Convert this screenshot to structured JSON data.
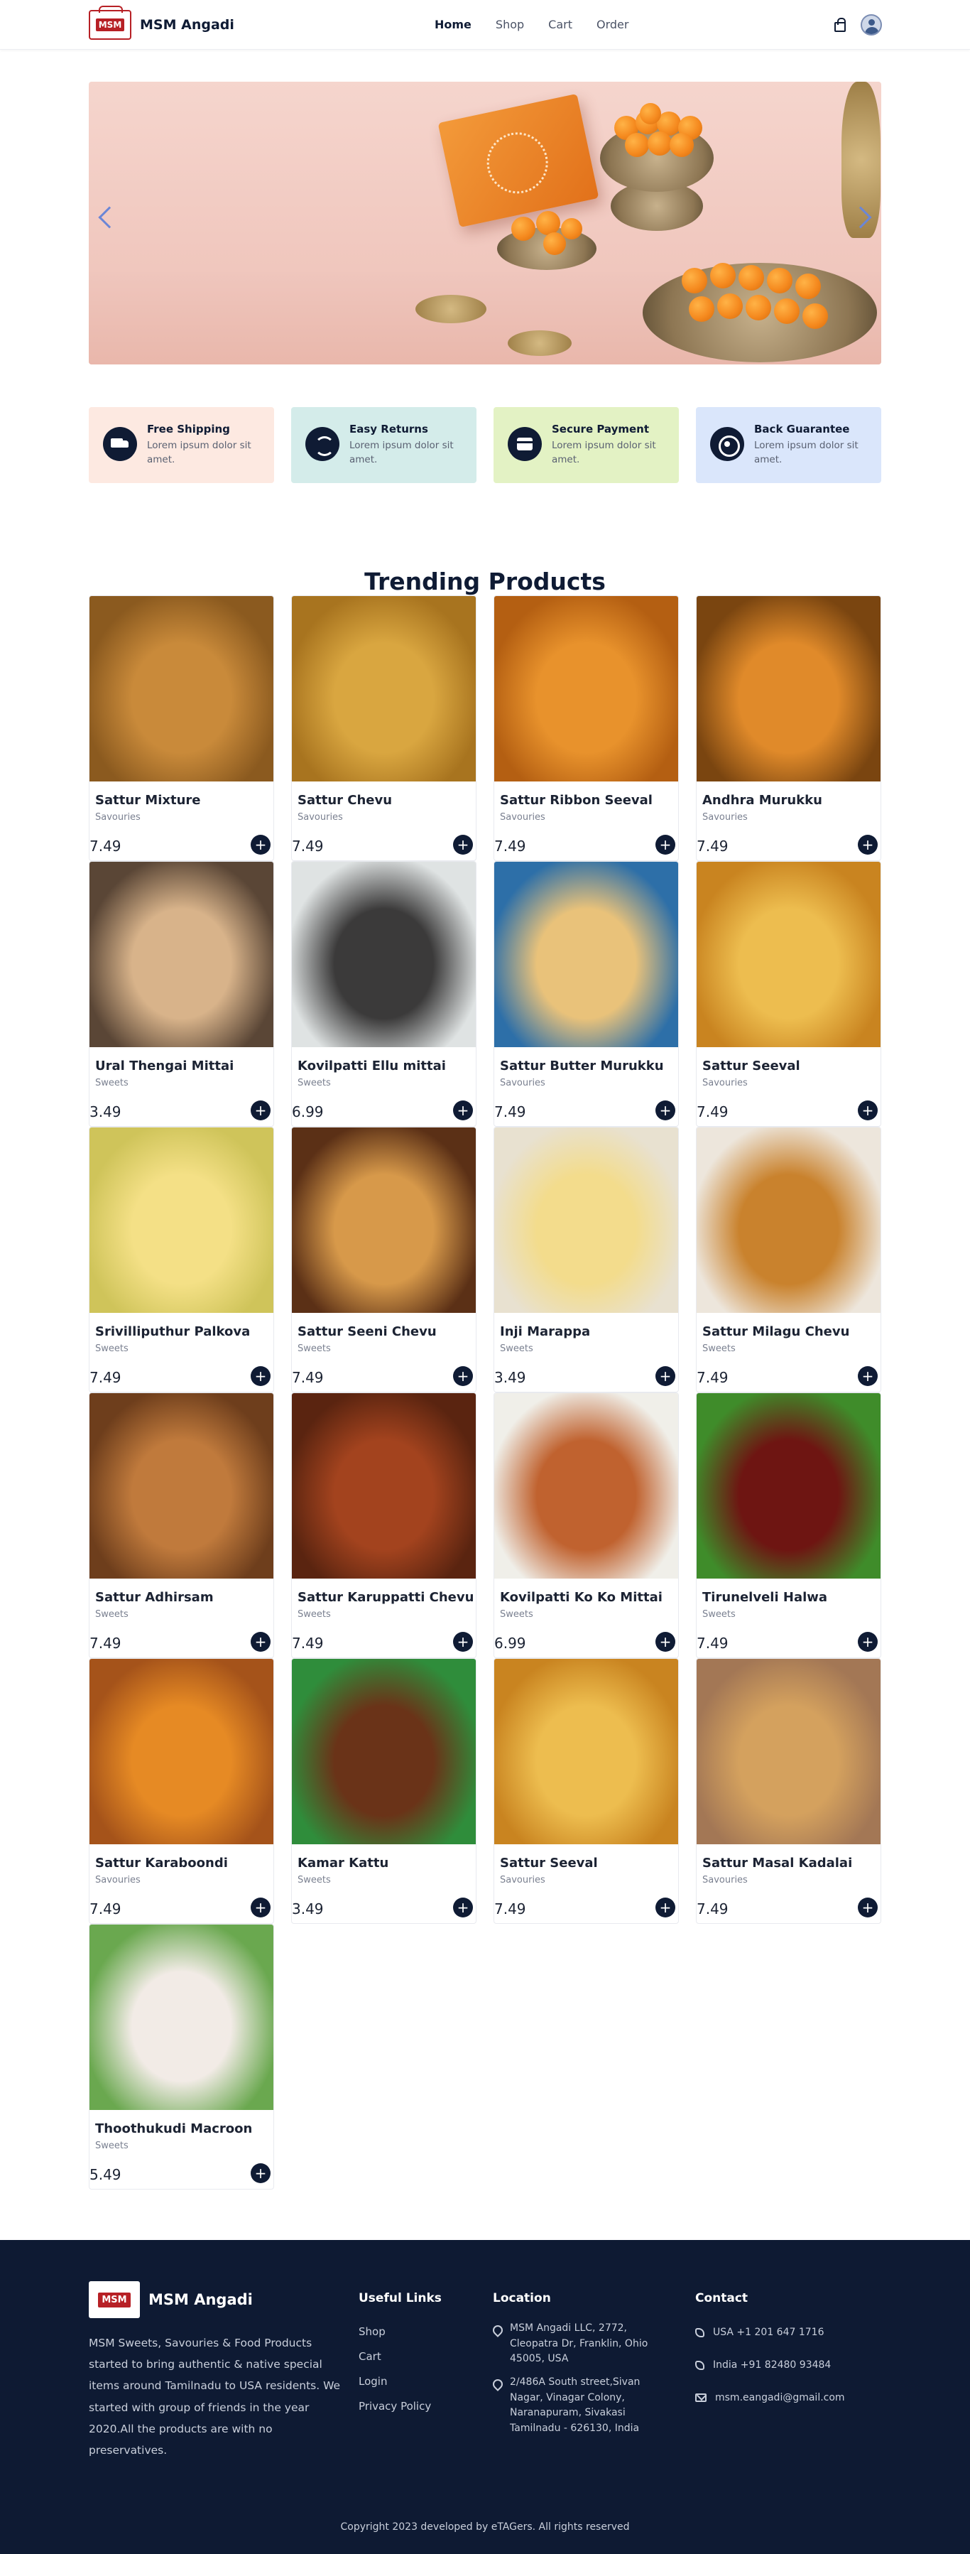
{
  "nav": {
    "brand": "MSM Angadi",
    "logo_text": "MSM",
    "links": [
      {
        "label": "Home",
        "active": true
      },
      {
        "label": "Shop",
        "active": false
      },
      {
        "label": "Cart",
        "active": false
      },
      {
        "label": "Order",
        "active": false
      }
    ]
  },
  "features": [
    {
      "title": "Free Shipping",
      "desc": "Lorem ipsum dolor sit amet.",
      "bg": "#fde9e1",
      "icon": "truck-icon"
    },
    {
      "title": "Easy Returns",
      "desc": "Lorem ipsum dolor sit amet.",
      "bg": "#d4ecea",
      "icon": "returns-icon"
    },
    {
      "title": "Secure Payment",
      "desc": "Lorem ipsum dolor sit amet.",
      "bg": "#e3f2c4",
      "icon": "payment-icon"
    },
    {
      "title": "Back Guarantee",
      "desc": "Lorem ipsum dolor sit amet.",
      "bg": "#dae6fb",
      "icon": "guarantee-icon"
    }
  ],
  "trending": {
    "title": "Trending Products",
    "products": [
      {
        "name": "Sattur Mixture",
        "category": "Savouries",
        "price": "7.49",
        "colors": [
          "#c98a3a",
          "#8b5a1f"
        ]
      },
      {
        "name": "Sattur Chevu",
        "category": "Savouries",
        "price": "7.49",
        "colors": [
          "#d9a640",
          "#a8741f"
        ]
      },
      {
        "name": "Sattur Ribbon Seeval",
        "category": "Savouries",
        "price": "7.49",
        "colors": [
          "#e8922c",
          "#b45f12"
        ]
      },
      {
        "name": "Andhra Murukku",
        "category": "Savouries",
        "price": "7.49",
        "colors": [
          "#e08a2a",
          "#7a4510"
        ]
      },
      {
        "name": "Ural Thengai Mittai",
        "category": "Sweets",
        "price": "3.49",
        "colors": [
          "#d8b38a",
          "#5a4636"
        ]
      },
      {
        "name": "Kovilpatti Ellu mittai",
        "category": "Sweets",
        "price": "6.99",
        "colors": [
          "#3b3a3a",
          "#dfe3e3"
        ]
      },
      {
        "name": "Sattur Butter Murukku",
        "category": "Savouries",
        "price": "7.49",
        "colors": [
          "#e9c27a",
          "#2d6fa8"
        ]
      },
      {
        "name": "Sattur Seeval",
        "category": "Savouries",
        "price": "7.49",
        "colors": [
          "#edbd4f",
          "#c98420"
        ]
      },
      {
        "name": "Srivilliputhur Palkova",
        "category": "Sweets",
        "price": "7.49",
        "colors": [
          "#f4e086",
          "#cfc45a"
        ]
      },
      {
        "name": "Sattur Seeni Chevu",
        "category": "Sweets",
        "price": "7.49",
        "colors": [
          "#d7994a",
          "#5b3016"
        ]
      },
      {
        "name": "Inji Marappa",
        "category": "Sweets",
        "price": "3.49",
        "colors": [
          "#f3dc8c",
          "#e8e1d0"
        ]
      },
      {
        "name": "Sattur Milagu Chevu",
        "category": "Sweets",
        "price": "7.49",
        "colors": [
          "#c9822d",
          "#ede6dc"
        ]
      },
      {
        "name": "Sattur Adhirsam",
        "category": "Sweets",
        "price": "7.49",
        "colors": [
          "#c07a3c",
          "#6e3e1c"
        ]
      },
      {
        "name": "Sattur Karuppatti Chevu",
        "category": "Sweets",
        "price": "7.49",
        "colors": [
          "#a3431e",
          "#5a2410"
        ]
      },
      {
        "name": "Kovilpatti Ko Ko Mittai",
        "category": "Sweets",
        "price": "6.99",
        "colors": [
          "#c0622f",
          "#f0efe9"
        ]
      },
      {
        "name": "Tirunelveli Halwa",
        "category": "Sweets",
        "price": "7.49",
        "colors": [
          "#6e1512",
          "#3f8c2a"
        ]
      },
      {
        "name": "Sattur Karaboondi",
        "category": "Savouries",
        "price": "7.49",
        "colors": [
          "#e68a24",
          "#a5531a"
        ]
      },
      {
        "name": "Kamar Kattu",
        "category": "Sweets",
        "price": "3.49",
        "colors": [
          "#6a3318",
          "#2f8d3b"
        ]
      },
      {
        "name": "Sattur Seeval",
        "category": "Savouries",
        "price": "7.49",
        "colors": [
          "#edbd4f",
          "#c98420"
        ]
      },
      {
        "name": "Sattur Masal Kadalai",
        "category": "Savouries",
        "price": "7.49",
        "colors": [
          "#d4a15e",
          "#a37755"
        ]
      },
      {
        "name": "Thoothukudi Macroon",
        "category": "Sweets",
        "price": "5.49",
        "colors": [
          "#f2ebe6",
          "#6aa84f"
        ]
      }
    ]
  },
  "footer": {
    "brand": "MSM Angadi",
    "logo_text": "MSM",
    "about": "MSM Sweets, Savouries & Food Products started to bring authentic & native special items around Tamilnadu to USA residents. We started with group of friends in the year 2020.All the products are with no preservatives.",
    "useful_links_title": "Useful Links",
    "useful_links": [
      "Shop",
      "Cart",
      "Login",
      "Privacy Policy"
    ],
    "location_title": "Location",
    "locations": [
      "MSM Angadi LLC, 2772, Cleopatra Dr, Franklin, Ohio 45005, USA",
      "2/486A South street,Sivan Nagar, Vinagar Colony, Naranapuram, Sivakasi Tamilnadu - 626130, India"
    ],
    "contact_title": "Contact",
    "contacts": [
      {
        "text": "USA +1 201 647 1716",
        "icon": "phone-icon"
      },
      {
        "text": "India +91 82480 93484",
        "icon": "phone-icon"
      },
      {
        "text": "msm.eangadi@gmail.com",
        "icon": "mail-icon"
      }
    ],
    "copyright": "Copyright 2023 developed by eTAGers. All rights reserved"
  }
}
